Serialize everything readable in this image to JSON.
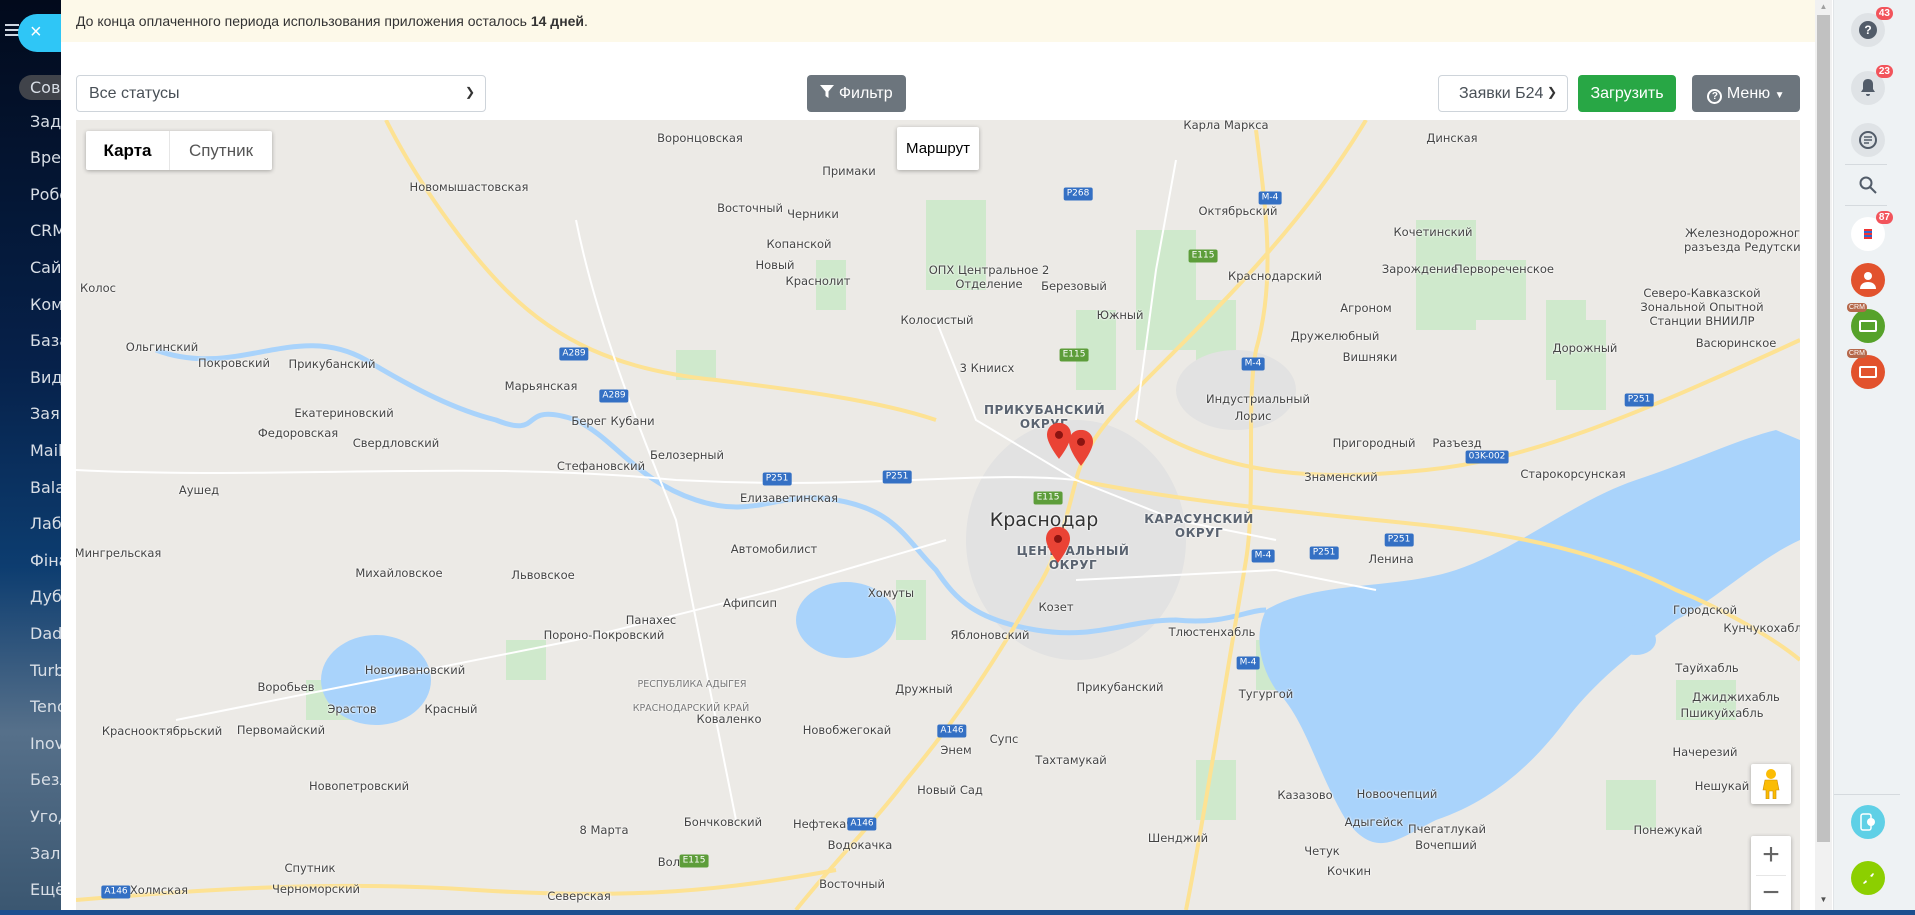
{
  "sidebar": {
    "close_icon": "×",
    "items": [
      {
        "label": "Совместная"
      },
      {
        "label": "Задачи"
      },
      {
        "label": "Время"
      },
      {
        "label": "Роботы"
      },
      {
        "label": "CRM"
      },
      {
        "label": "Сайты"
      },
      {
        "label": "Компания"
      },
      {
        "label": "База"
      },
      {
        "label": "Видео"
      },
      {
        "label": "Заявки"
      },
      {
        "label": "Mail"
      },
      {
        "label": "Balance"
      },
      {
        "label": "Лаборатория"
      },
      {
        "label": "Фінанси"
      },
      {
        "label": "Дубли"
      },
      {
        "label": "Dadata"
      },
      {
        "label": "Turbo"
      },
      {
        "label": "Tenols"
      },
      {
        "label": "Inova"
      },
      {
        "label": "Безлимит"
      },
      {
        "label": "Угоды"
      },
      {
        "label": "Залежи"
      },
      {
        "label": "Ещё"
      }
    ]
  },
  "banner": {
    "text": "До конца оплаченного периода использования приложения осталось ",
    "bold": "14 дней",
    "end": "."
  },
  "toolbar": {
    "status_select": "Все статусы",
    "filter_label": "Фильтр",
    "source_select": "Заявки Б24",
    "load_label": "Загрузить",
    "menu_label": "Меню"
  },
  "map": {
    "type_map": "Карта",
    "type_satellite": "Спутник",
    "route_label": "Маршрут",
    "zoom_in": "+",
    "zoom_out": "−",
    "labels": [
      "Воронцовская",
      "Карла Маркса",
      "Динская",
      "Новомышастовская",
      "Примаки",
      "Восточный",
      "Черники",
      "Октябрьский",
      "Кочетинский",
      "Железнодорожного разъезда Редутский",
      "Колос",
      "Копанской",
      "Новый",
      "Краснолит",
      "ОПХ Центральное 2 Отделение",
      "Березовый",
      "Краснодарский",
      "Зарождение",
      "Первореченское",
      "Агроном",
      "Северо-Кавказской Зональной Опытной Станции ВНИИЛР",
      "Колосистый",
      "Южный",
      "Дружелюбный",
      "Вишняки",
      "Дорожный",
      "Васюринское",
      "Ольгинский",
      "Покровский",
      "Прикубанский",
      "3 Книисх",
      "Марьянская",
      "Индустриальный",
      "Лорис",
      "Екатериновский",
      "Берег Кубани",
      "ПРИКУБАНСКИЙ ОКРУГ",
      "Пригородный",
      "Разъезд",
      "Федоровская",
      "Свердловский",
      "Стефановский",
      "Белозерный",
      "Знаменский",
      "Старокорсунская",
      "Аушед",
      "Елизаветинская",
      "Краснодар",
      "КАРАСУНСКИЙ ОКРУГ",
      "Мингрельская",
      "Автомобилист",
      "ЦЕНТРАЛЬНЫЙ ОКРУГ",
      "Ленина",
      "Городской",
      "Михайловское",
      "Львовское",
      "Хомуты",
      "Афипсип",
      "Козет",
      "Панахес",
      "Кунчукохабль",
      "Пороно-Покровский",
      "Яблоновский",
      "Тлюстенхабль",
      "Новоивановский",
      "РЕСПУБЛИКА АДЫГЕЯ",
      "Тауйхабль",
      "Воробьев",
      "Дружный",
      "Прикубанский",
      "Тугургой",
      "Джиджихабль",
      "КРАСНОДАРСКИЙ КРАЙ",
      "Эрастов",
      "Красный",
      "Коваленко",
      "Пшикуйхабль",
      "Краснооктябрьский",
      "Первомайский",
      "Новобжегокай",
      "Супс",
      "Начерезий",
      "Энем",
      "Тахтамукай",
      "Новопетровский",
      "Казазово",
      "Новоочепций",
      "Нешукай",
      "Новый Сад",
      "Бончковский",
      "Нефтекачка",
      "Адыгейск",
      "Пчегатлукай",
      "Понежукай",
      "8 Марта",
      "Водокачка",
      "Шенджий",
      "Вочепший",
      "Воликов",
      "Четук",
      "Спутник",
      "Кочкин",
      "Восточный",
      "Черноморский",
      "Холмская",
      "Северская"
    ],
    "shields": [
      "P268",
      "M-4",
      "E115",
      "A289",
      "A289",
      "E115",
      "M-4",
      "P251",
      "03K-002",
      "P251",
      "P251",
      "E115",
      "P251",
      "P251",
      "M-4",
      "M-4",
      "A146",
      "A146",
      "E115",
      "A146"
    ]
  },
  "right_panel": {
    "help_badge": "43",
    "notify_badge": "23",
    "app_badge": "87",
    "crm_label": "CRM"
  }
}
